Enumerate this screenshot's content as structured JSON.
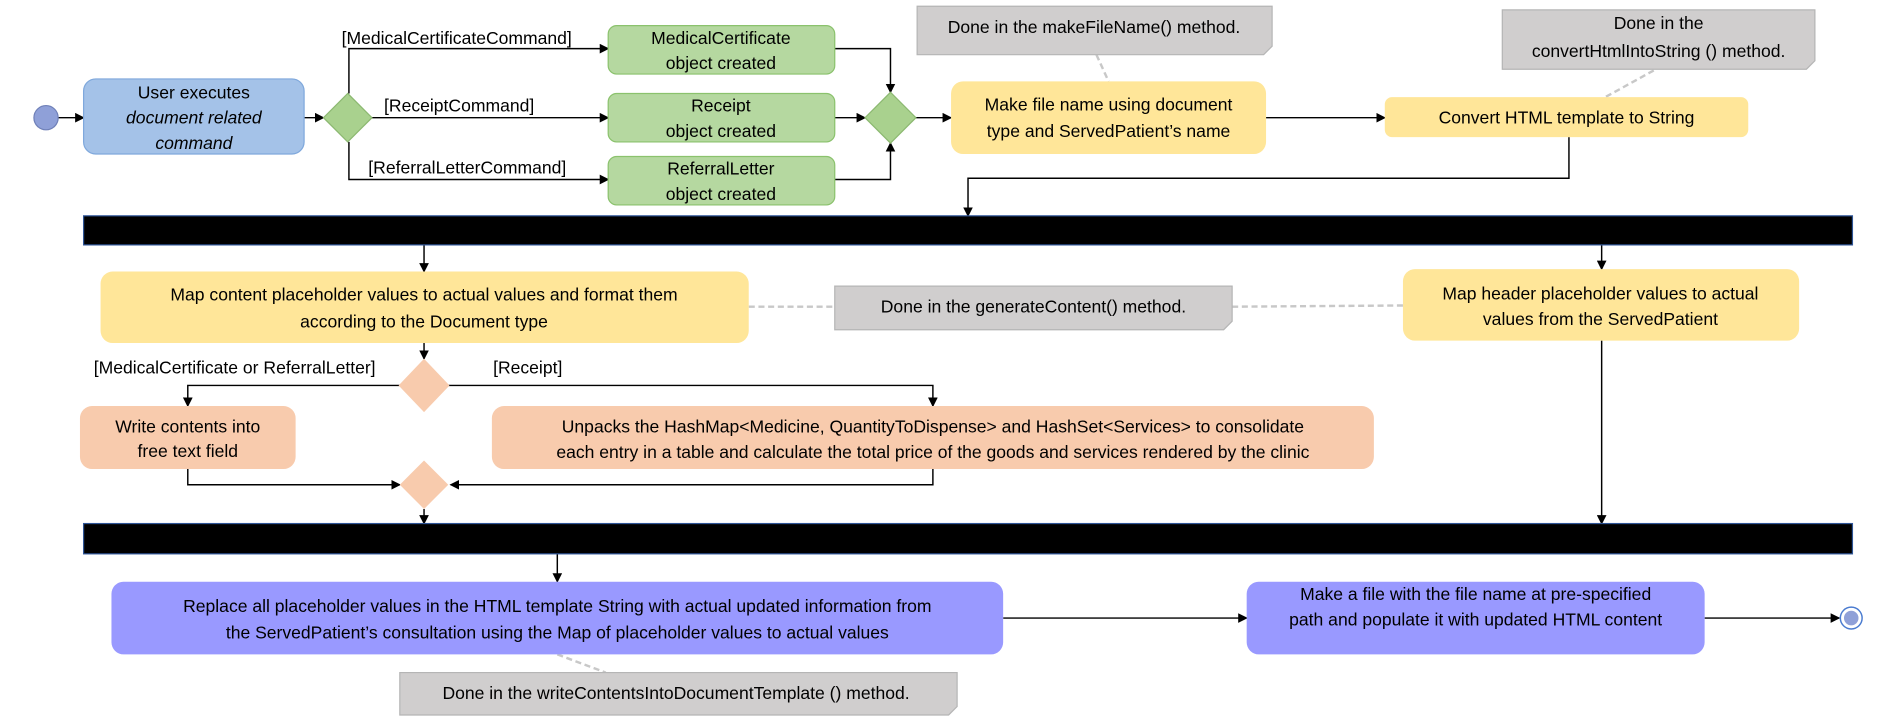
{
  "colors": {
    "start_node": "#8fa0d8",
    "user_action": "#a4c2e8",
    "object_created": "#b5d8a0",
    "decision_green": "#a9d18e",
    "process_yellow": "#ffe699",
    "process_orange": "#f8cbad",
    "process_purple": "#9999ff",
    "note_gray": "#d0cece",
    "fork_bar": "#000000"
  },
  "nodes": {
    "user_action": [
      "User executes",
      "document related",
      "command"
    ],
    "medical_certificate": [
      "MedicalCertificate",
      "object created"
    ],
    "receipt": [
      "Receipt",
      "object created"
    ],
    "referral_letter": [
      "ReferralLetter",
      "object created"
    ],
    "make_file_name": [
      "Make file name using document",
      "type and ServedPatient’s name"
    ],
    "convert_html": "Convert HTML template to String",
    "map_content": [
      "Map content placeholder values to actual values and format them",
      "according to the Document type"
    ],
    "map_header": [
      "Map header placeholder values to actual",
      "values from the ServedPatient"
    ],
    "write_contents": [
      "Write contents into",
      "free text field"
    ],
    "unpack_hashmap": [
      "Unpacks the HashMap<Medicine, QuantityToDispense>  and HashSet<Services>  to consolidate",
      "each entry in a table and calculate the total price of the goods and services rendered by the clinic"
    ],
    "replace_placeholders": [
      "Replace all placeholder values in the HTML template String with actual updated information from",
      "the ServedPatient’s consultation using the Map of placeholder values to actual values"
    ],
    "make_file": [
      "Make a file with the file name at pre-specified",
      "path and populate it with updated HTML content"
    ]
  },
  "guards": {
    "medical_certificate_command": "[MedicalCertificateCommand]",
    "receipt_command": "[ReceiptCommand]",
    "referral_letter_command": "[ReferralLetterCommand]",
    "mc_or_referral": "[MedicalCertificate or ReferralLetter]",
    "receipt": "[Receipt]"
  },
  "notes": {
    "make_file_name": "Done in the makeFileName() method.",
    "convert_html": [
      "Done in the",
      "convertHtmlIntoString () method."
    ],
    "generate_content": "Done in the generateContent()  method.",
    "write_contents": "Done in the writeContentsIntoDocumentTemplate  () method."
  }
}
